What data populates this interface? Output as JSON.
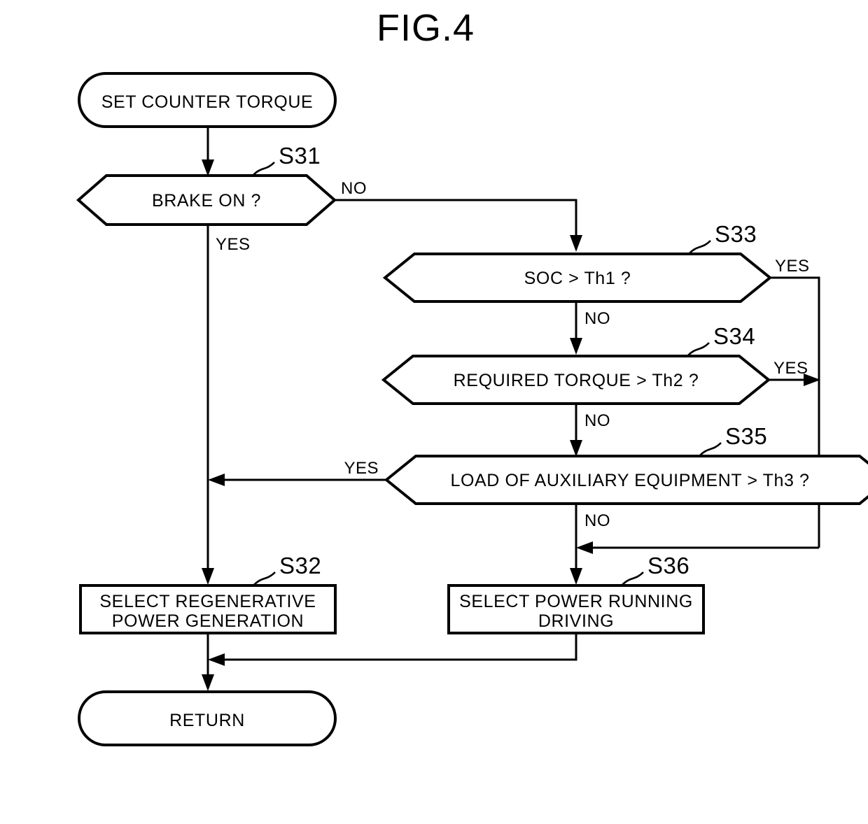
{
  "figure": {
    "title": "FIG.4"
  },
  "nodes": {
    "start": {
      "label": "SET COUNTER TORQUE"
    },
    "s31": {
      "step": "S31",
      "label": "BRAKE ON ?"
    },
    "s33": {
      "step": "S33",
      "label": "SOC > Th1 ?"
    },
    "s34": {
      "step": "S34",
      "label": "REQUIRED TORQUE > Th2 ?"
    },
    "s35": {
      "step": "S35",
      "label": "LOAD OF AUXILIARY EQUIPMENT > Th3 ?"
    },
    "s32": {
      "step": "S32",
      "label_line1": "SELECT REGENERATIVE",
      "label_line2": "POWER GENERATION"
    },
    "s36": {
      "step": "S36",
      "label_line1": "SELECT POWER RUNNING",
      "label_line2": "DRIVING"
    },
    "end": {
      "label": "RETURN"
    }
  },
  "branches": {
    "s31_no": "NO",
    "s31_yes": "YES",
    "s33_yes": "YES",
    "s33_no": "NO",
    "s34_yes": "YES",
    "s34_no": "NO",
    "s35_yes": "YES",
    "s35_no": "NO"
  },
  "colors": {
    "stroke": "#000000",
    "fill": "#ffffff",
    "background": "#ffffff"
  }
}
